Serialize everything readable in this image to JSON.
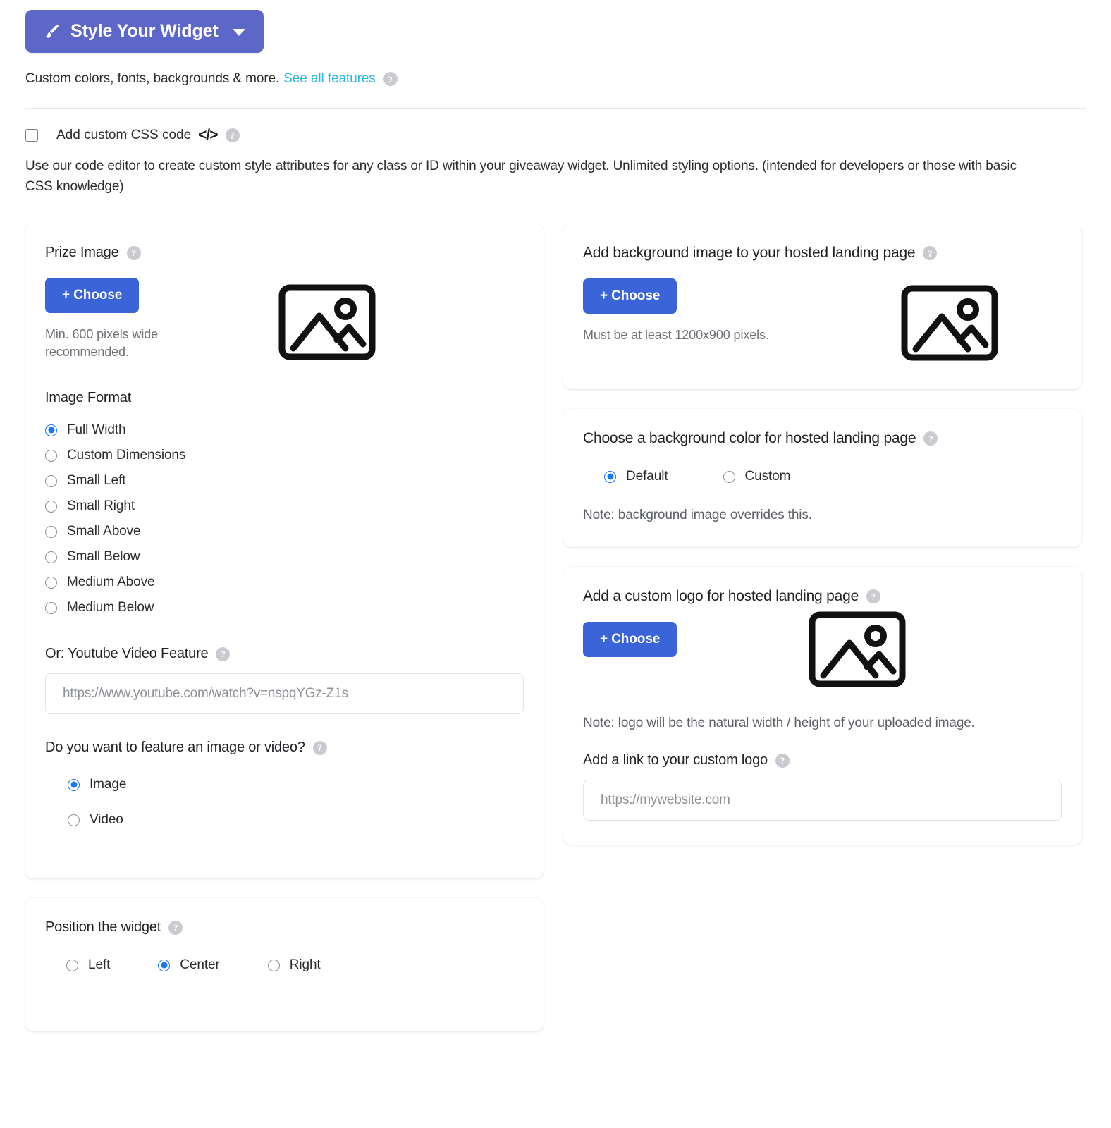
{
  "header": {
    "style_button_label": "Style Your Widget",
    "brush_icon": "paintbrush-icon",
    "caret_icon": "chevron-down-icon",
    "subtitle_text": "Custom colors, fonts, backgrounds & more.",
    "subtitle_link": "See all features",
    "help_icon": "question-mark-icon"
  },
  "custom_css": {
    "checkbox_label": "Add custom CSS code",
    "code_glyph": "</>",
    "description": "Use our code editor to create custom style attributes for any class or ID within your giveaway widget. Unlimited styling options. (intended for developers or those with basic CSS knowledge)",
    "checked": false
  },
  "prize_image": {
    "title": "Prize Image",
    "choose_label": "+ Choose",
    "hint": "Min. 600 pixels wide recommended.",
    "placeholder_icon": "image-placeholder-icon",
    "format_label": "Image Format",
    "format_options": [
      {
        "label": "Full Width",
        "selected": true
      },
      {
        "label": "Custom Dimensions",
        "selected": false
      },
      {
        "label": "Small Left",
        "selected": false
      },
      {
        "label": "Small Right",
        "selected": false
      },
      {
        "label": "Small Above",
        "selected": false
      },
      {
        "label": "Small Below",
        "selected": false
      },
      {
        "label": "Medium Above",
        "selected": false
      },
      {
        "label": "Medium Below",
        "selected": false
      }
    ],
    "youtube_label": "Or: Youtube Video Feature",
    "youtube_placeholder": "https://www.youtube.com/watch?v=nspqYGz-Z1s",
    "youtube_value": "",
    "feature_label": "Do you want to feature an image or video?",
    "feature_options": [
      {
        "label": "Image",
        "selected": true
      },
      {
        "label": "Video",
        "selected": false
      }
    ]
  },
  "position_widget": {
    "title": "Position the widget",
    "options": [
      {
        "label": "Left",
        "selected": false
      },
      {
        "label": "Center",
        "selected": true
      },
      {
        "label": "Right",
        "selected": false
      }
    ]
  },
  "background_image": {
    "title": "Add background image to your hosted landing page",
    "choose_label": "+ Choose",
    "hint": "Must be at least 1200x900 pixels.",
    "placeholder_icon": "image-placeholder-icon"
  },
  "background_color": {
    "title": "Choose a background color for hosted landing page",
    "options": [
      {
        "label": "Default",
        "selected": true
      },
      {
        "label": "Custom",
        "selected": false
      }
    ],
    "note": "Note: background image overrides this."
  },
  "custom_logo": {
    "title": "Add a custom logo for hosted landing page",
    "choose_label": "+ Choose",
    "placeholder_icon": "image-placeholder-icon",
    "note": "Note: logo will be the natural width / height of your uploaded image.",
    "link_label": "Add a link to your custom logo",
    "link_placeholder": "https://mywebsite.com",
    "link_value": ""
  },
  "colors": {
    "brand_indigo": "#5c67c8",
    "action_blue": "#3b64d9",
    "link_cyan": "#29b6e8",
    "radio_blue": "#1877f2",
    "help_gray": "#c9cbd0",
    "text_dark": "#2b2b2b",
    "text_muted": "#6e7177"
  }
}
